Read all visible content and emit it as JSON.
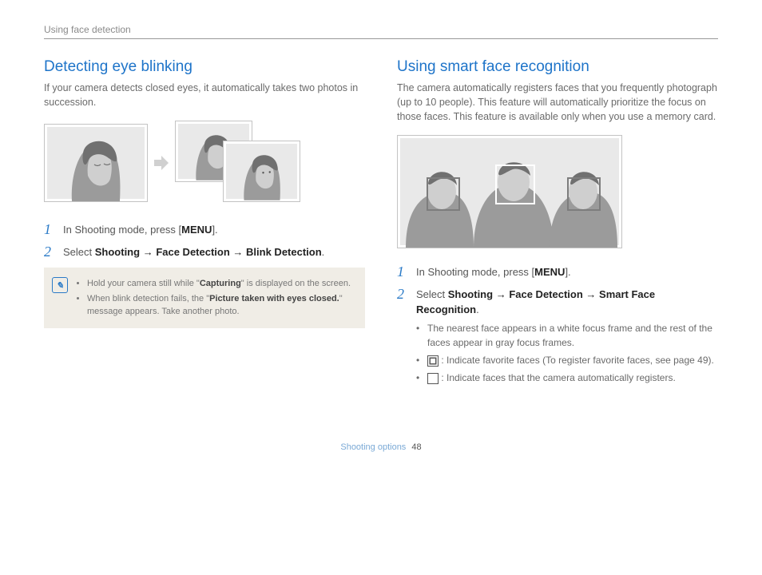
{
  "header": {
    "breadcrumb": "Using face detection"
  },
  "left": {
    "title": "Detecting eye blinking",
    "intro": "If your camera detects closed eyes, it automatically takes two photos in succession.",
    "step1_prefix": "In Shooting mode, press [",
    "step1_key": "MENU",
    "step1_suffix": "].",
    "step2_prefix": "Select ",
    "step2_path_a": "Shooting",
    "step2_arrow": " → ",
    "step2_path_b": "Face Detection",
    "step2_path_c": "Blink Detection",
    "step2_suffix": ".",
    "note1_a": "Hold your camera still while \"",
    "note1_b": "Capturing",
    "note1_c": "\" is displayed on the screen.",
    "note2_a": "When blink detection fails, the \"",
    "note2_b": "Picture taken with eyes closed.",
    "note2_c": "\" message appears. Take another photo."
  },
  "right": {
    "title": "Using smart face recognition",
    "intro": "The camera automatically registers faces that you frequently photograph (up to 10 people). This feature will automatically prioritize the focus on those faces. This feature is available only when you use a memory card.",
    "step1_prefix": "In Shooting mode, press [",
    "step1_key": "MENU",
    "step1_suffix": "].",
    "step2_prefix": "Select ",
    "step2_path_a": "Shooting",
    "step2_arrow": " → ",
    "step2_path_b": "Face Detection",
    "step2_path_c": "Smart Face Recognition",
    "step2_suffix": ".",
    "bullet1": "The nearest face appears in a white focus frame and the rest of the faces appear in gray focus frames.",
    "bullet2": " : Indicate favorite faces (To register favorite faces, see page 49).",
    "bullet3": " : Indicate faces that the camera automatically registers."
  },
  "footer": {
    "section": "Shooting options",
    "page": "48"
  }
}
